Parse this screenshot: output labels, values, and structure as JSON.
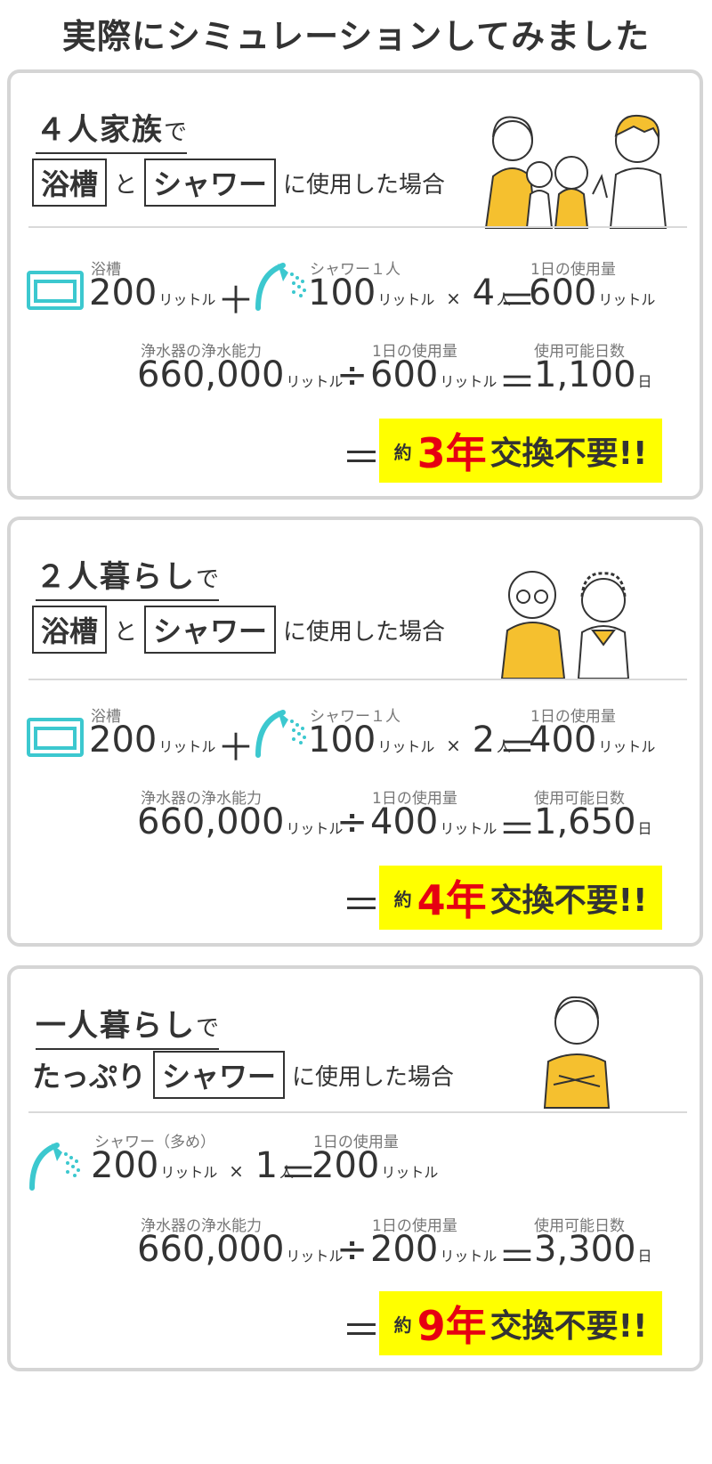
{
  "page_title": "実際にシミュレーションしてみました",
  "units": {
    "liter": "リットル",
    "day": "日",
    "person": "人",
    "approx": "約",
    "times": "×",
    "plus": "＋",
    "equals": "＝",
    "divide": "÷"
  },
  "labels": {
    "bath": "浴槽",
    "shower_per_person": "シャワー１人",
    "shower_heavy": "シャワー（多め）",
    "daily_use": "1日の使用量",
    "filter_capacity": "浄水器の浄水能力",
    "usable_days": "使用可能日数",
    "no_replacement": "交換不要!!",
    "year": "年"
  },
  "cards": [
    {
      "heading": "４人家族",
      "heading_suffix": "で",
      "line2_prefix": "",
      "box1": "浴槽",
      "conn": "と",
      "box2": "シャワー",
      "line2_suffix": "に使用した場合",
      "bath_liters": "200",
      "shower_liters": "100",
      "people": "4",
      "daily_total": "600",
      "capacity": "660,000",
      "days": "1,100",
      "years": "3"
    },
    {
      "heading": "２人暮らし",
      "heading_suffix": "で",
      "line2_prefix": "",
      "box1": "浴槽",
      "conn": "と",
      "box2": "シャワー",
      "line2_suffix": "に使用した場合",
      "bath_liters": "200",
      "shower_liters": "100",
      "people": "2",
      "daily_total": "400",
      "capacity": "660,000",
      "days": "1,650",
      "years": "4"
    },
    {
      "heading": "一人暮らし",
      "heading_suffix": "で",
      "line2_prefix": "たっぷり",
      "box2": "シャワー",
      "line2_suffix": "に使用した場合",
      "shower_liters": "200",
      "people": "1",
      "daily_total": "200",
      "capacity": "660,000",
      "days": "3,300",
      "years": "9"
    }
  ],
  "colors": {
    "accent_teal": "#3cc8cf",
    "highlight": "#ffff00",
    "red": "#e60012",
    "illustration_yellow": "#f5c02f"
  },
  "icons": [
    "bathtub-icon",
    "shower-head-icon",
    "family-illustration",
    "elderly-couple-illustration",
    "single-man-illustration"
  ]
}
